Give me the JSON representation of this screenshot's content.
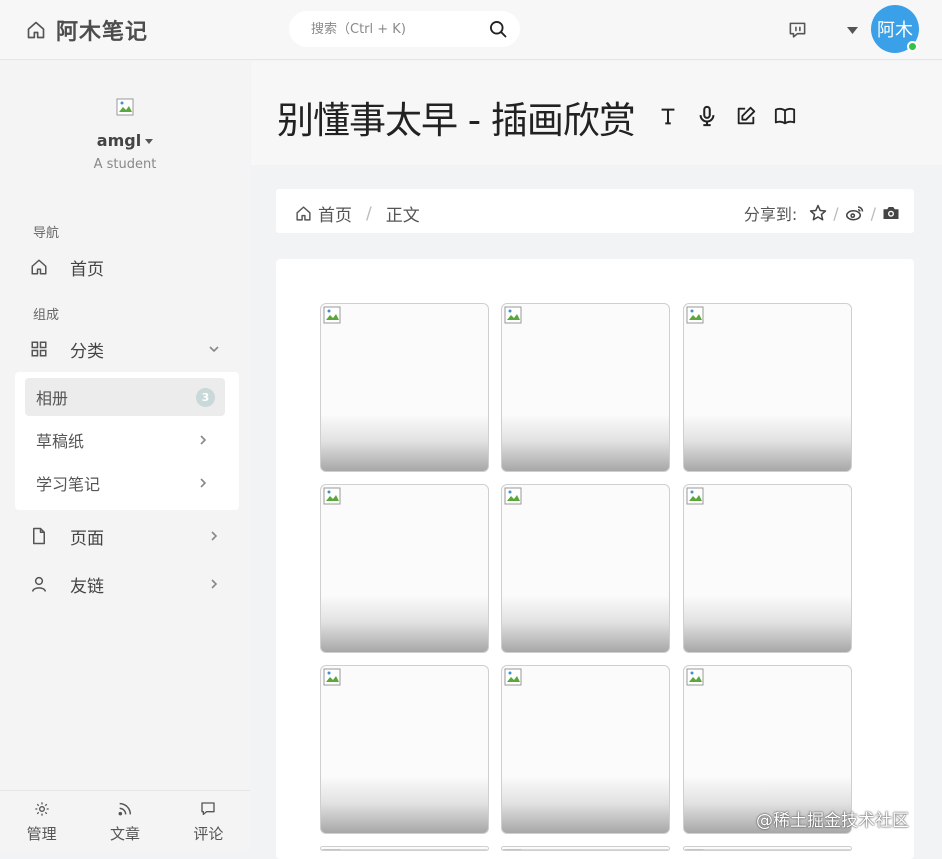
{
  "app": {
    "title": "阿木笔记"
  },
  "search": {
    "placeholder": "搜索（Ctrl + K)"
  },
  "avatar": {
    "text": "阿木"
  },
  "profile": {
    "name": "amgl",
    "subtitle": "A student"
  },
  "sidebar": {
    "nav_heading": "导航",
    "home_label": "首页",
    "group_heading": "组成",
    "category_label": "分类",
    "sub_items": [
      {
        "label": "相册",
        "count": "3"
      },
      {
        "label": "草稿纸"
      },
      {
        "label": "学习笔记"
      }
    ],
    "pages_label": "页面",
    "links_label": "友链"
  },
  "bottom_bar": {
    "manage": "管理",
    "articles": "文章",
    "comments": "评论"
  },
  "page": {
    "title": "别懂事太早 - 插画欣赏"
  },
  "breadcrumb": {
    "home": "首页",
    "current": "正文"
  },
  "share": {
    "label": "分享到:"
  },
  "gallery": {
    "count": 9
  },
  "watermark": {
    "text": "@稀土掘金技术社区"
  },
  "colors": {
    "accent": "#3aa0e8",
    "online": "#35c04a",
    "badge": "#c9d8d9"
  },
  "icons": [
    "home-icon",
    "search-icon",
    "message-icon",
    "caret-down-icon",
    "grid-icon",
    "chevron-down-icon",
    "chevron-right-icon",
    "file-icon",
    "user-icon",
    "gear-icon",
    "rss-icon",
    "comment-icon",
    "text-icon",
    "mic-icon",
    "edit-icon",
    "book-icon",
    "star-icon",
    "weibo-icon",
    "camera-icon",
    "broken-image-icon"
  ]
}
